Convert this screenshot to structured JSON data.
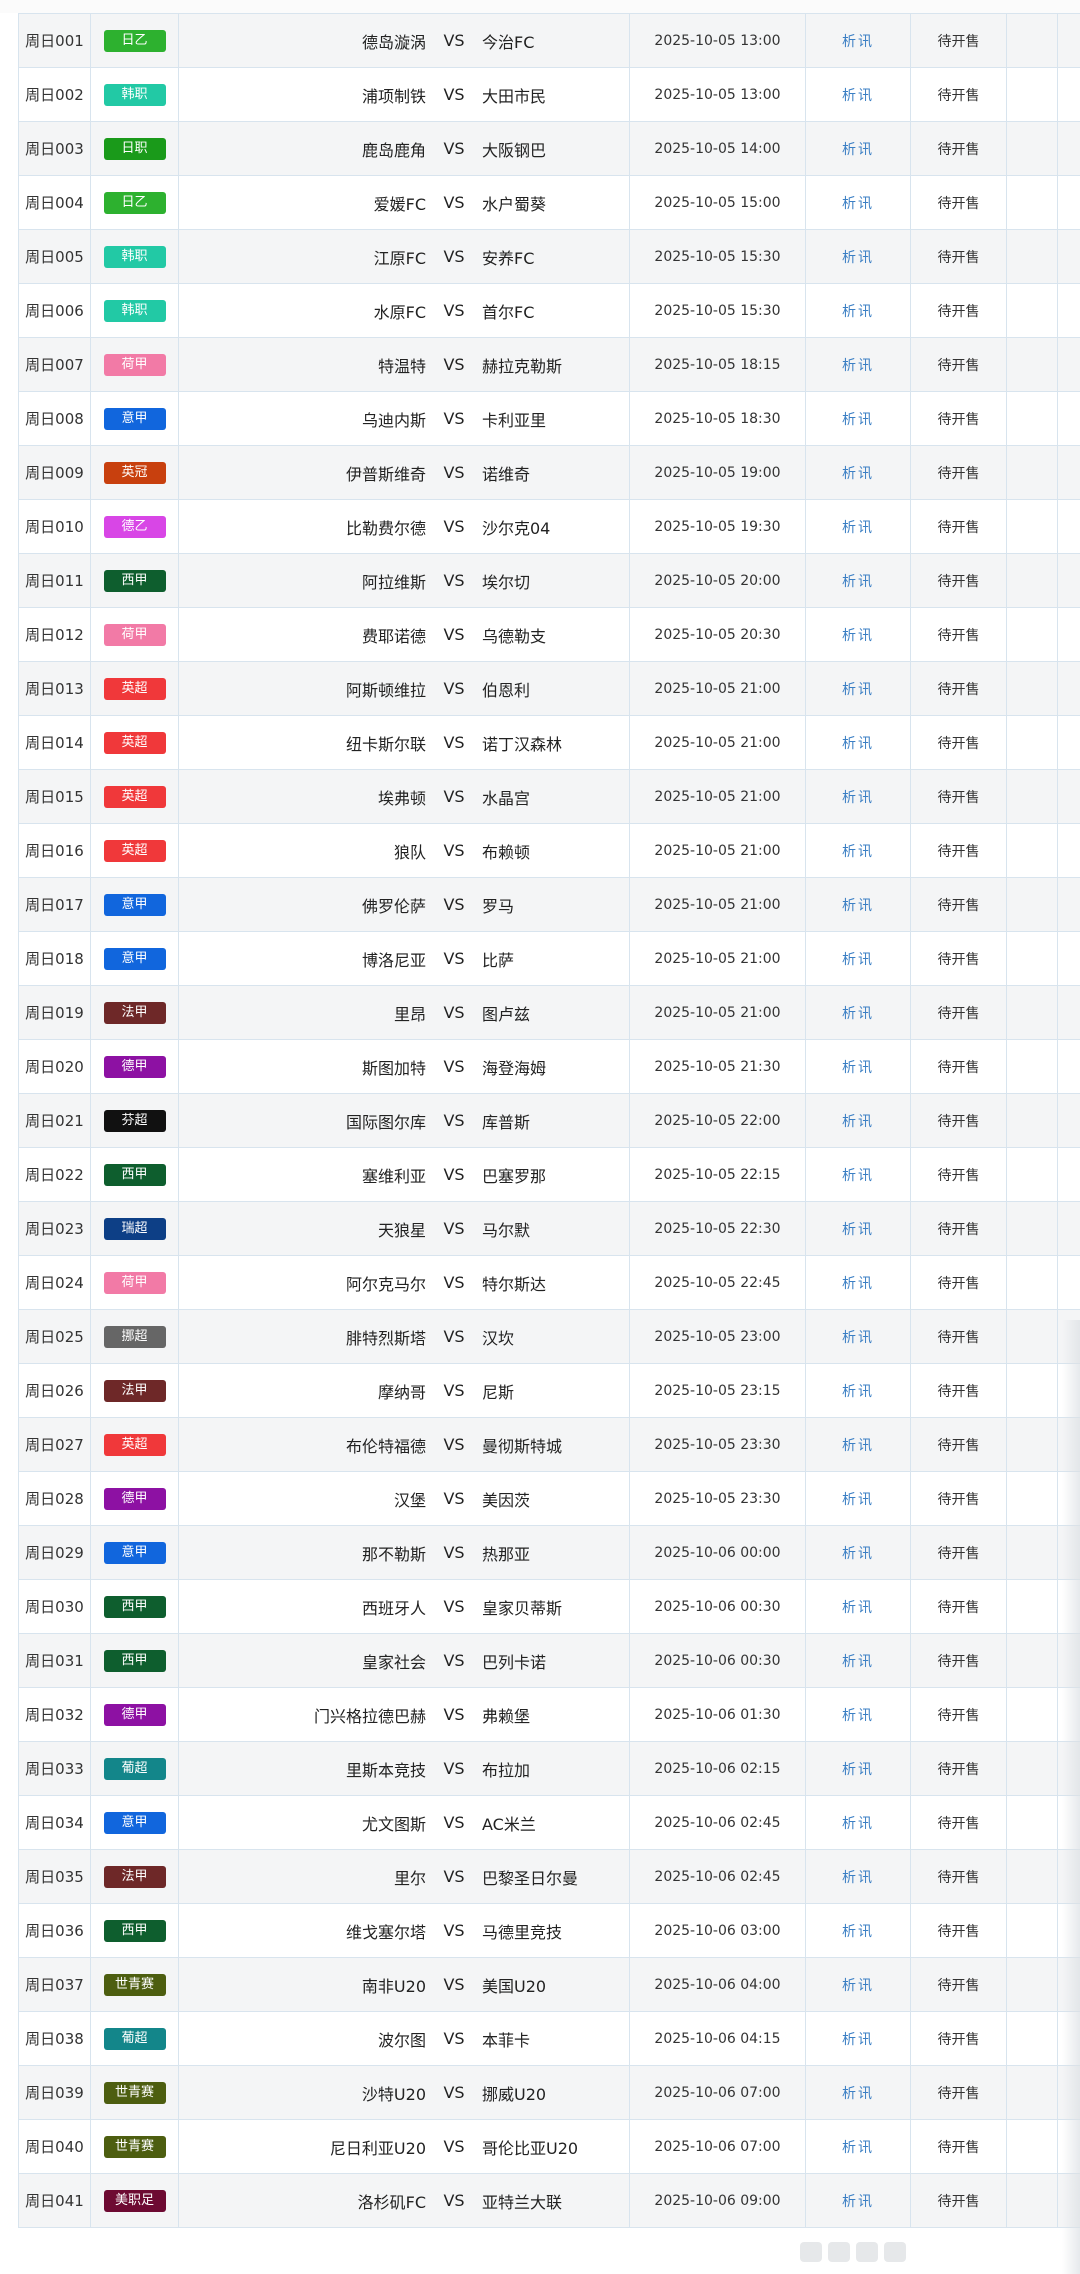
{
  "status_label": "待开售",
  "analysis_label": "析讯",
  "vs_label": "VS",
  "league_colors": {
    "日乙": "#2db12f",
    "韩职": "#22c9a5",
    "日职": "#1a9a1a",
    "荷甲": "#f27aa6",
    "意甲": "#1166dd",
    "英冠": "#c8400e",
    "德乙": "#d846e6",
    "西甲": "#0e5e2e",
    "英超": "#f0383a",
    "法甲": "#6e2828",
    "德甲": "#8d11a3",
    "芬超": "#111111",
    "瑞超": "#0d3f86",
    "挪超": "#666666",
    "葡超": "#13868a",
    "世青赛": "#4d5e10",
    "美职足": "#6d0a32"
  },
  "matches": [
    {
      "no": "周日001",
      "league": "日乙",
      "home": "德岛漩涡",
      "away": "今治FC",
      "time": "2025-10-05 13:00"
    },
    {
      "no": "周日002",
      "league": "韩职",
      "home": "浦项制铁",
      "away": "大田市民",
      "time": "2025-10-05 13:00"
    },
    {
      "no": "周日003",
      "league": "日职",
      "home": "鹿岛鹿角",
      "away": "大阪钢巴",
      "time": "2025-10-05 14:00"
    },
    {
      "no": "周日004",
      "league": "日乙",
      "home": "爱媛FC",
      "away": "水户蜀葵",
      "time": "2025-10-05 15:00"
    },
    {
      "no": "周日005",
      "league": "韩职",
      "home": "江原FC",
      "away": "安养FC",
      "time": "2025-10-05 15:30"
    },
    {
      "no": "周日006",
      "league": "韩职",
      "home": "水原FC",
      "away": "首尔FC",
      "time": "2025-10-05 15:30"
    },
    {
      "no": "周日007",
      "league": "荷甲",
      "home": "特温特",
      "away": "赫拉克勒斯",
      "time": "2025-10-05 18:15"
    },
    {
      "no": "周日008",
      "league": "意甲",
      "home": "乌迪内斯",
      "away": "卡利亚里",
      "time": "2025-10-05 18:30"
    },
    {
      "no": "周日009",
      "league": "英冠",
      "home": "伊普斯维奇",
      "away": "诺维奇",
      "time": "2025-10-05 19:00"
    },
    {
      "no": "周日010",
      "league": "德乙",
      "home": "比勒费尔德",
      "away": "沙尔克04",
      "time": "2025-10-05 19:30"
    },
    {
      "no": "周日011",
      "league": "西甲",
      "home": "阿拉维斯",
      "away": "埃尔切",
      "time": "2025-10-05 20:00"
    },
    {
      "no": "周日012",
      "league": "荷甲",
      "home": "费耶诺德",
      "away": "乌德勒支",
      "time": "2025-10-05 20:30"
    },
    {
      "no": "周日013",
      "league": "英超",
      "home": "阿斯顿维拉",
      "away": "伯恩利",
      "time": "2025-10-05 21:00"
    },
    {
      "no": "周日014",
      "league": "英超",
      "home": "纽卡斯尔联",
      "away": "诺丁汉森林",
      "time": "2025-10-05 21:00"
    },
    {
      "no": "周日015",
      "league": "英超",
      "home": "埃弗顿",
      "away": "水晶宫",
      "time": "2025-10-05 21:00"
    },
    {
      "no": "周日016",
      "league": "英超",
      "home": "狼队",
      "away": "布赖顿",
      "time": "2025-10-05 21:00"
    },
    {
      "no": "周日017",
      "league": "意甲",
      "home": "佛罗伦萨",
      "away": "罗马",
      "time": "2025-10-05 21:00"
    },
    {
      "no": "周日018",
      "league": "意甲",
      "home": "博洛尼亚",
      "away": "比萨",
      "time": "2025-10-05 21:00"
    },
    {
      "no": "周日019",
      "league": "法甲",
      "home": "里昂",
      "away": "图卢兹",
      "time": "2025-10-05 21:00"
    },
    {
      "no": "周日020",
      "league": "德甲",
      "home": "斯图加特",
      "away": "海登海姆",
      "time": "2025-10-05 21:30"
    },
    {
      "no": "周日021",
      "league": "芬超",
      "home": "国际图尔库",
      "away": "库普斯",
      "time": "2025-10-05 22:00"
    },
    {
      "no": "周日022",
      "league": "西甲",
      "home": "塞维利亚",
      "away": "巴塞罗那",
      "time": "2025-10-05 22:15"
    },
    {
      "no": "周日023",
      "league": "瑞超",
      "home": "天狼星",
      "away": "马尔默",
      "time": "2025-10-05 22:30"
    },
    {
      "no": "周日024",
      "league": "荷甲",
      "home": "阿尔克马尔",
      "away": "特尔斯达",
      "time": "2025-10-05 22:45"
    },
    {
      "no": "周日025",
      "league": "挪超",
      "home": "腓特烈斯塔",
      "away": "汉坎",
      "time": "2025-10-05 23:00"
    },
    {
      "no": "周日026",
      "league": "法甲",
      "home": "摩纳哥",
      "away": "尼斯",
      "time": "2025-10-05 23:15"
    },
    {
      "no": "周日027",
      "league": "英超",
      "home": "布伦特福德",
      "away": "曼彻斯特城",
      "time": "2025-10-05 23:30"
    },
    {
      "no": "周日028",
      "league": "德甲",
      "home": "汉堡",
      "away": "美因茨",
      "time": "2025-10-05 23:30"
    },
    {
      "no": "周日029",
      "league": "意甲",
      "home": "那不勒斯",
      "away": "热那亚",
      "time": "2025-10-06 00:00"
    },
    {
      "no": "周日030",
      "league": "西甲",
      "home": "西班牙人",
      "away": "皇家贝蒂斯",
      "time": "2025-10-06 00:30"
    },
    {
      "no": "周日031",
      "league": "西甲",
      "home": "皇家社会",
      "away": "巴列卡诺",
      "time": "2025-10-06 00:30"
    },
    {
      "no": "周日032",
      "league": "德甲",
      "home": "门兴格拉德巴赫",
      "away": "弗赖堡",
      "time": "2025-10-06 01:30"
    },
    {
      "no": "周日033",
      "league": "葡超",
      "home": "里斯本竞技",
      "away": "布拉加",
      "time": "2025-10-06 02:15"
    },
    {
      "no": "周日034",
      "league": "意甲",
      "home": "尤文图斯",
      "away": "AC米兰",
      "time": "2025-10-06 02:45"
    },
    {
      "no": "周日035",
      "league": "法甲",
      "home": "里尔",
      "away": "巴黎圣日尔曼",
      "time": "2025-10-06 02:45"
    },
    {
      "no": "周日036",
      "league": "西甲",
      "home": "维戈塞尔塔",
      "away": "马德里竞技",
      "time": "2025-10-06 03:00"
    },
    {
      "no": "周日037",
      "league": "世青赛",
      "home": "南非U20",
      "away": "美国U20",
      "time": "2025-10-06 04:00"
    },
    {
      "no": "周日038",
      "league": "葡超",
      "home": "波尔图",
      "away": "本菲卡",
      "time": "2025-10-06 04:15"
    },
    {
      "no": "周日039",
      "league": "世青赛",
      "home": "沙特U20",
      "away": "挪威U20",
      "time": "2025-10-06 07:00"
    },
    {
      "no": "周日040",
      "league": "世青赛",
      "home": "尼日利亚U20",
      "away": "哥伦比亚U20",
      "time": "2025-10-06 07:00"
    },
    {
      "no": "周日041",
      "league": "美职足",
      "home": "洛杉矶FC",
      "away": "亚特兰大联",
      "time": "2025-10-06 09:00"
    }
  ]
}
